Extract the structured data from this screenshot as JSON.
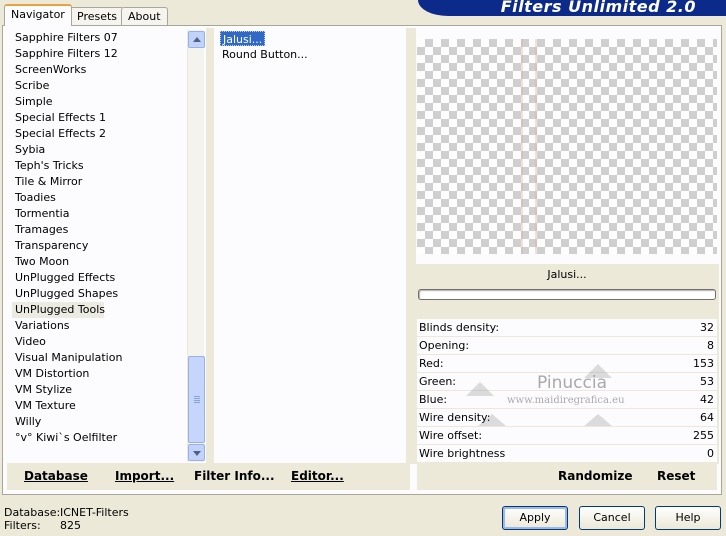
{
  "app": {
    "title": "Filters Unlimited 2.0"
  },
  "tabs": [
    {
      "label": "Navigator",
      "active": true
    },
    {
      "label": "Presets",
      "active": false
    },
    {
      "label": "About",
      "active": false
    }
  ],
  "categories": {
    "items": [
      "Sapphire Filters 07",
      "Sapphire Filters 12",
      "ScreenWorks",
      "Scribe",
      "Simple",
      "Special Effects 1",
      "Special Effects 2",
      "Sybia",
      "Teph's Tricks",
      "Tile & Mirror",
      "Toadies",
      "Tormentia",
      "Tramages",
      "Transparency",
      "Two Moon",
      "UnPlugged Effects",
      "UnPlugged Shapes",
      "UnPlugged Tools",
      "Variations",
      "Video",
      "Visual Manipulation",
      "VM Distortion",
      "VM Stylize",
      "VM Texture",
      "Willy",
      "°v° Kiwi`s Oelfilter"
    ],
    "selected": "UnPlugged Tools"
  },
  "filters": {
    "items": [
      "Jalusi...",
      "Round Button..."
    ],
    "selected": "Jalusi..."
  },
  "preview": {
    "label": "Jalusi...",
    "progress": 0
  },
  "parameters": [
    {
      "name": "Blinds density:",
      "value": "32"
    },
    {
      "name": "Opening:",
      "value": "8"
    },
    {
      "name": "Red:",
      "value": "153"
    },
    {
      "name": "Green:",
      "value": "53"
    },
    {
      "name": "Blue:",
      "value": "42"
    },
    {
      "name": "Wire density:",
      "value": "64"
    },
    {
      "name": "Wire offset:",
      "value": "255"
    },
    {
      "name": "Wire brightness",
      "value": "0"
    }
  ],
  "watermark": {
    "title": "Pinuccia",
    "url": "www.maidiregrafica.eu"
  },
  "toolbar_left": {
    "database": "Database",
    "import": "Import...",
    "filter_info": "Filter Info...",
    "editor": "Editor..."
  },
  "toolbar_right": {
    "randomize": "Randomize",
    "reset": "Reset"
  },
  "status": {
    "database_label": "Database:",
    "database_value": "ICNET-Filters",
    "filters_label": "Filters:",
    "filters_value": "825"
  },
  "buttons": {
    "apply": "Apply",
    "cancel": "Cancel",
    "help": "Help"
  },
  "colors": {
    "banner": "#0c2a8a",
    "selection": "#316ac5",
    "window_bg": "#ece9d8"
  }
}
